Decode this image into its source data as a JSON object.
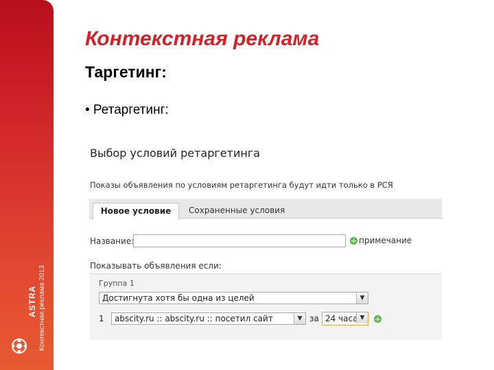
{
  "sidebar": {
    "vertical_text": "Контекстная реклама 2013",
    "logo_text": "ASTRA",
    "bg_color": "#d2282c"
  },
  "slide": {
    "title": "Контекстная реклама",
    "subtitle": "Таргетинг:",
    "bullet": "• Ретаргетинг:"
  },
  "panel": {
    "heading": "Выбор условий ретаргетинга",
    "note": "Показы объявления по условиям ретаргетинга будут идти только в РСЯ",
    "tabs": [
      {
        "label": "Новое условие",
        "active": true
      },
      {
        "label": "Сохраненные условия",
        "active": false
      }
    ],
    "name_label": "Название:",
    "name_value": "",
    "note_link": "примечание",
    "show_label": "Показывать объявления если:",
    "group": {
      "title": "Группа 1",
      "goal_value": "Достигнута хотя бы одна из целей",
      "row_number": "1",
      "site_value": "abscity.ru :: abscity.ru :: посетил сайт",
      "za_label": "за",
      "period_value": "24 часа"
    }
  }
}
